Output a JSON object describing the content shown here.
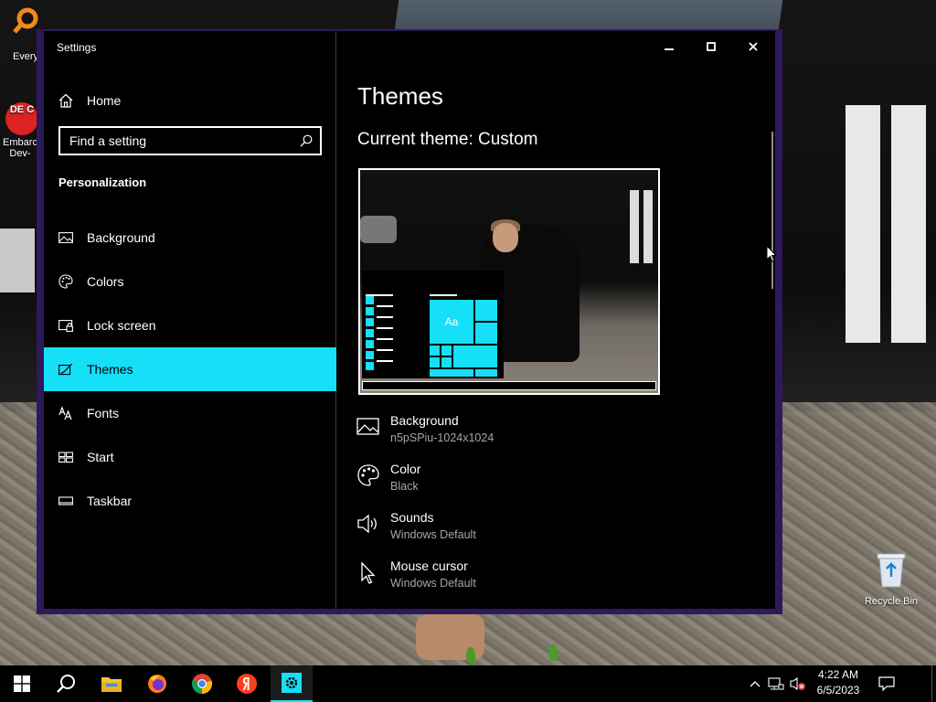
{
  "window": {
    "title": "Settings",
    "controls": {
      "minimize": "minimize",
      "maximize": "maximize",
      "close": "close"
    }
  },
  "sidebar": {
    "home_label": "Home",
    "search_placeholder": "Find a setting",
    "section_title": "Personalization",
    "items": [
      {
        "label": "Background",
        "icon": "picture-icon",
        "active": false
      },
      {
        "label": "Colors",
        "icon": "palette-icon",
        "active": false
      },
      {
        "label": "Lock screen",
        "icon": "lock-screen-icon",
        "active": false
      },
      {
        "label": "Themes",
        "icon": "themes-icon",
        "active": true
      },
      {
        "label": "Fonts",
        "icon": "fonts-icon",
        "active": false
      },
      {
        "label": "Start",
        "icon": "start-icon",
        "active": false
      },
      {
        "label": "Taskbar",
        "icon": "taskbar-icon",
        "active": false
      }
    ]
  },
  "main": {
    "title": "Themes",
    "current_theme": "Current theme: Custom",
    "preview_tile_label": "Aa",
    "properties": [
      {
        "title": "Background",
        "value": "n5pSPiu-1024x1024",
        "icon": "picture-icon"
      },
      {
        "title": "Color",
        "value": "Black",
        "icon": "palette-icon"
      },
      {
        "title": "Sounds",
        "value": "Windows Default",
        "icon": "speaker-icon"
      },
      {
        "title": "Mouse cursor",
        "value": "Windows Default",
        "icon": "cursor-icon"
      }
    ]
  },
  "desktop": {
    "icons": [
      {
        "label": "Every"
      },
      {
        "label": "Embarc Dev-"
      },
      {
        "label": "Recycle Bin"
      }
    ]
  },
  "taskbar": {
    "time": "4:22 AM",
    "date": "6/5/2023",
    "apps": [
      "File Explorer",
      "Firefox",
      "Chrome",
      "Yandex",
      "Settings"
    ]
  },
  "colors": {
    "accent": "#16dff8",
    "window_bg": "#000000",
    "border": "#2c1a5a",
    "secondary_text": "#a6a6a6"
  }
}
